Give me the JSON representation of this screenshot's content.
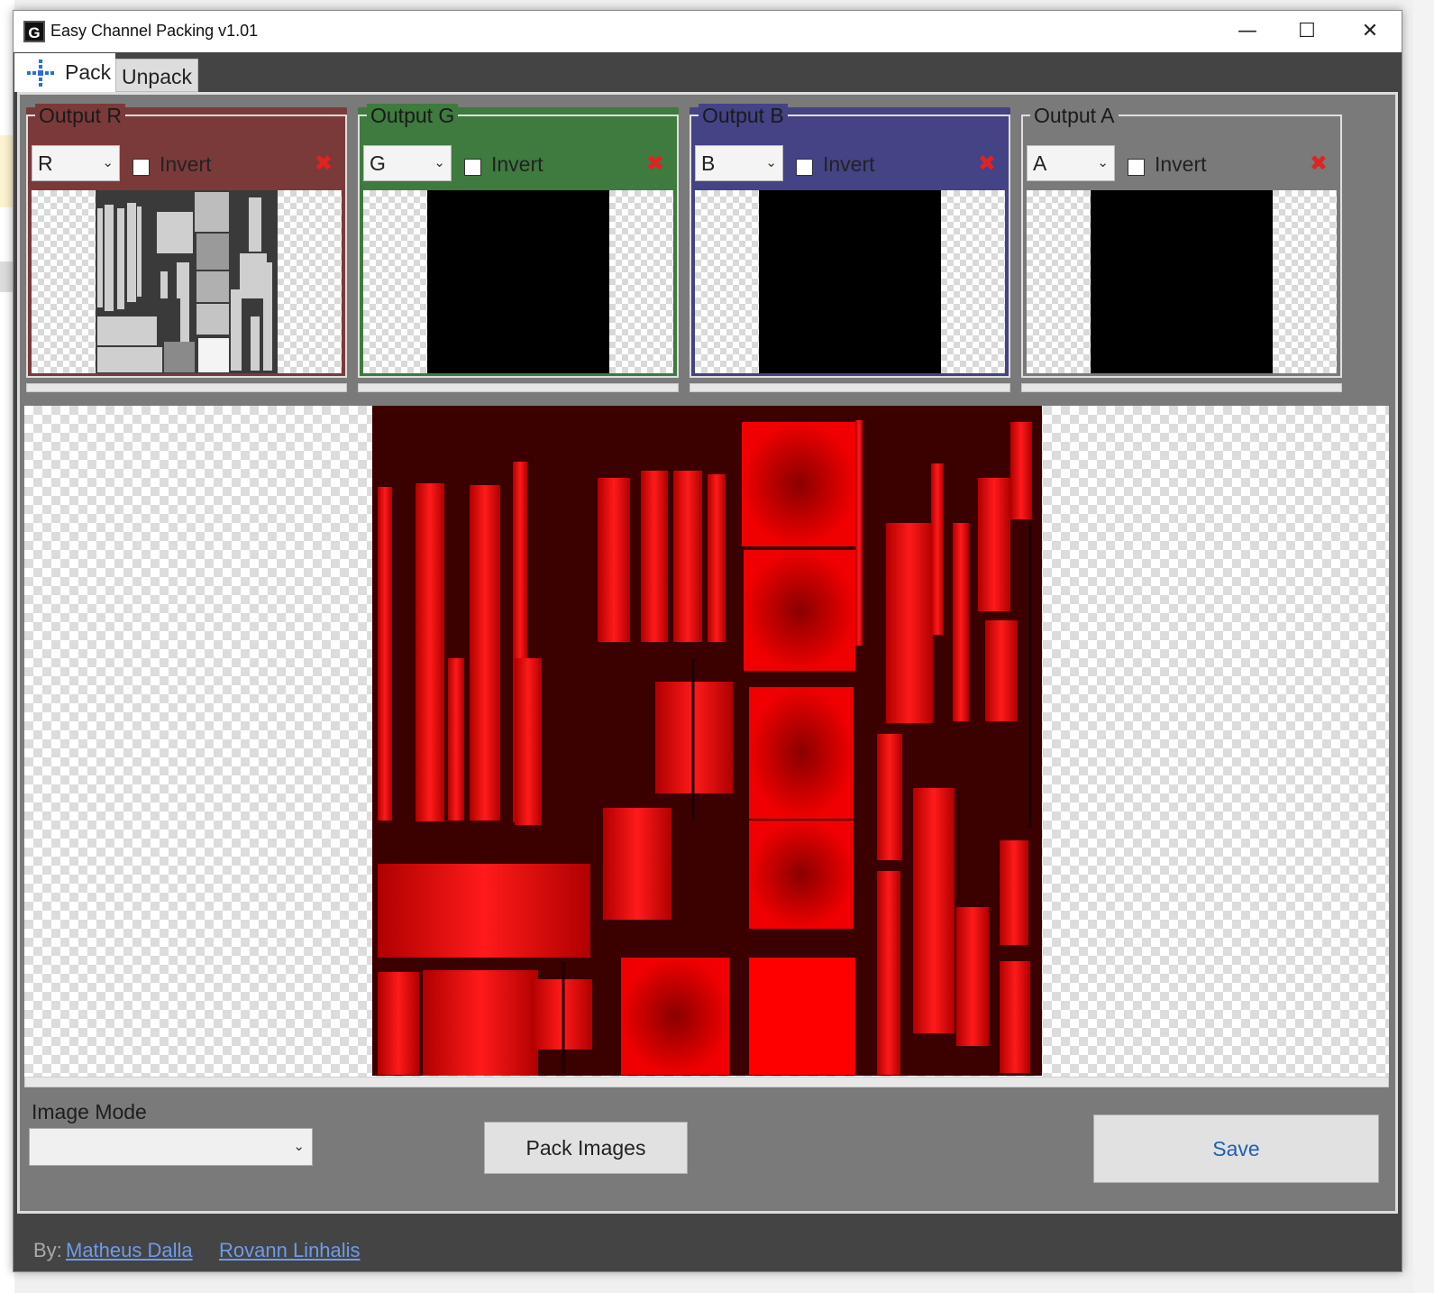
{
  "window": {
    "title": "Easy Channel Packing v1.01",
    "icon": "app-logo-icon",
    "controls": {
      "minimize": "—",
      "maximize": "☐",
      "close": "✕"
    }
  },
  "tabs": [
    {
      "label": "Pack",
      "icon": "pack-arrows-icon",
      "active": true
    },
    {
      "label": "Unpack",
      "active": false
    }
  ],
  "outputs": [
    {
      "legend": "Output R",
      "channel": "R",
      "invert_label": "Invert",
      "invert_checked": false,
      "color": "#7b3a3a"
    },
    {
      "legend": "Output G",
      "channel": "G",
      "invert_label": "Invert",
      "invert_checked": false,
      "color": "#3f7a3f"
    },
    {
      "legend": "Output B",
      "channel": "B",
      "invert_label": "Invert",
      "invert_checked": false,
      "color": "#434385"
    },
    {
      "legend": "Output A",
      "channel": "A",
      "invert_label": "Invert",
      "invert_checked": false,
      "color": "#7a7a7a"
    }
  ],
  "image_mode": {
    "label": "Image Mode",
    "value": ""
  },
  "buttons": {
    "pack": "Pack Images",
    "save": "Save"
  },
  "footer": {
    "by": "By:",
    "authors": [
      "Matheus Dalla",
      "Rovann Linhalis"
    ]
  },
  "colors": {
    "accent_link": "#6f9be8",
    "remove_x": "#e22222",
    "packed_bg": "#3b0000",
    "packed_fg": "#ff0000"
  }
}
